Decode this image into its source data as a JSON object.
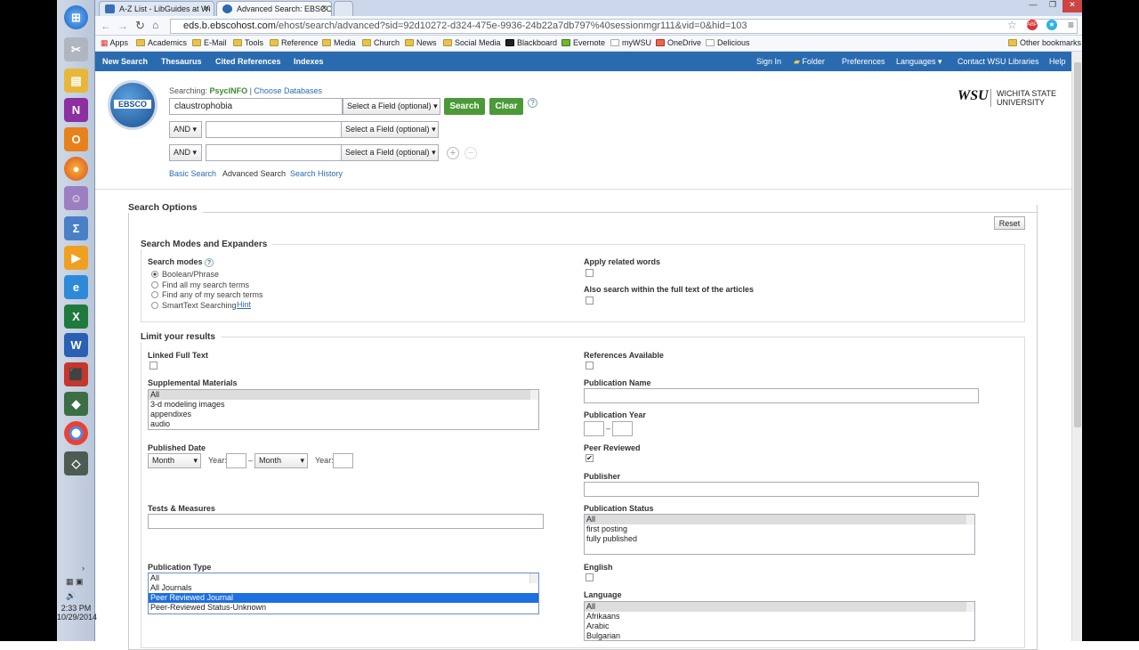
{
  "browser": {
    "tabs": [
      {
        "label": "A-Z List - LibGuides at Wi"
      },
      {
        "label": "Advanced Search: EBSCO"
      }
    ],
    "url_host": "eds.b.ebscohost.com",
    "url_rest": "/ehost/search/advanced?sid=92d10272-d324-475e-9936-24b22a7db797%40sessionmgr111&vid=0&hid=103",
    "bookmarks": [
      "Apps",
      "Academics",
      "E-Mail",
      "Tools",
      "Reference",
      "Media",
      "Church",
      "News",
      "Social Media",
      "Blackboard",
      "Evernote",
      "myWSU",
      "OneDrive",
      "Delicious"
    ],
    "other_bookmarks": "Other bookmarks"
  },
  "taskbar": {
    "time": "2:33 PM",
    "date": "10/29/2014"
  },
  "nav": {
    "left": [
      "New Search",
      "Thesaurus",
      "Cited References",
      "Indexes"
    ],
    "right": [
      "Sign In",
      "Folder",
      "Preferences",
      "Languages ▾",
      "Contact WSU Libraries",
      "Help"
    ]
  },
  "search": {
    "logo": "EBSCO",
    "searching_label": "Searching:",
    "database": "PsycINFO",
    "choose_db": "Choose Databases",
    "query1": "claustrophobia",
    "field_select": "Select a Field (optional)",
    "op": "AND",
    "search_btn": "Search",
    "clear_btn": "Clear",
    "help": "?",
    "links": [
      "Basic Search",
      "Advanced Search",
      "Search History"
    ],
    "wsu_line1": "WICHITA STATE",
    "wsu_line2": "UNIVERSITY",
    "wsu_mark": "WSU"
  },
  "options": {
    "title": "Search Options",
    "reset": "Reset",
    "modes_title": "Search Modes and Expanders",
    "search_modes_label": "Search modes",
    "modes": [
      "Boolean/Phrase",
      "Find all my search terms",
      "Find any of my search terms",
      "SmartText Searching"
    ],
    "hint": "Hint",
    "apply_related": "Apply related words",
    "full_text_search": "Also search within the full text of the articles",
    "limit_title": "Limit your results",
    "linked_full_text": "Linked Full Text",
    "references_available": "References Available",
    "supplemental_label": "Supplemental Materials",
    "supplemental": [
      "All",
      "3-d modeling images",
      "appendixes",
      "audio"
    ],
    "publication_name": "Publication Name",
    "publication_year": "Publication Year",
    "published_date": "Published Date",
    "month": "Month",
    "year": "Year:",
    "dash": "–",
    "peer_reviewed": "Peer Reviewed",
    "publisher": "Publisher",
    "tests_measures": "Tests & Measures",
    "publication_status_label": "Publication Status",
    "publication_status": [
      "All",
      "first posting",
      "fully published"
    ],
    "publication_type_label": "Publication Type",
    "publication_type": [
      "All",
      "All Journals",
      "Peer Reviewed Journal",
      "Peer-Reviewed Status-Unknown"
    ],
    "english": "English",
    "language_label": "Language",
    "languages": [
      "All",
      "Afrikaans",
      "Arabic",
      "Bulgarian"
    ]
  }
}
